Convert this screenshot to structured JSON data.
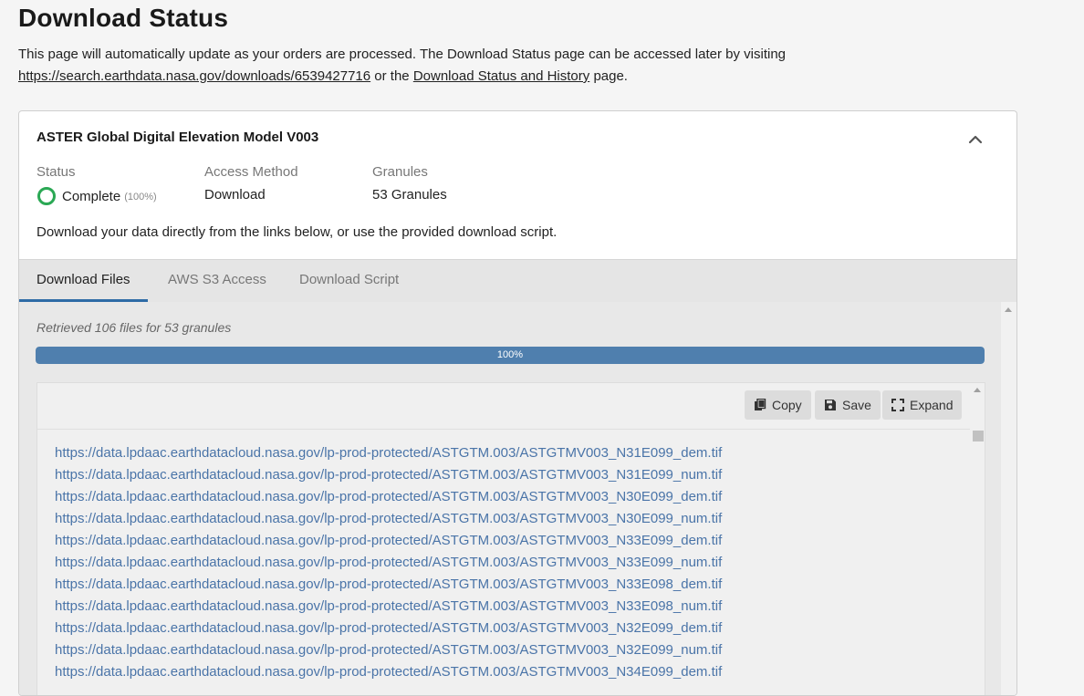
{
  "page": {
    "title": "Download Status",
    "intro_text": "This page will automatically update as your orders are processed. The Download Status page can be accessed later by visiting",
    "intro_link_url": "https://search.earthdata.nasa.gov/downloads/6539427716",
    "intro_or": "or the",
    "intro_link_history": "Download Status and History",
    "intro_end": "page."
  },
  "order": {
    "title": "ASTER Global Digital Elevation Model V003",
    "collapse_icon": "chevron-up-icon",
    "status_label": "Status",
    "status_value": "Complete",
    "status_percent": "(100%)",
    "status_color": "#2aa854",
    "access_label": "Access Method",
    "access_value": "Download",
    "granules_label": "Granules",
    "granules_value": "53 Granules",
    "description": "Download your data directly from the links below, or use the provided download script."
  },
  "tabs": [
    {
      "label": "Download Files",
      "active": true
    },
    {
      "label": "AWS S3 Access",
      "active": false
    },
    {
      "label": "Download Script",
      "active": false
    }
  ],
  "files": {
    "retrieved_text": "Retrieved 106 files for 53 granules",
    "progress_value": 100,
    "progress_label": "100%",
    "progress_color": "#4f7fae",
    "toolbar": {
      "copy_label": "Copy",
      "copy_icon": "copy-icon",
      "save_label": "Save",
      "save_icon": "floppy-disk-icon",
      "expand_label": "Expand",
      "expand_icon": "expand-icon"
    },
    "links": [
      "https://data.lpdaac.earthdatacloud.nasa.gov/lp-prod-protected/ASTGTM.003/ASTGTMV003_N31E099_dem.tif",
      "https://data.lpdaac.earthdatacloud.nasa.gov/lp-prod-protected/ASTGTM.003/ASTGTMV003_N31E099_num.tif",
      "https://data.lpdaac.earthdatacloud.nasa.gov/lp-prod-protected/ASTGTM.003/ASTGTMV003_N30E099_dem.tif",
      "https://data.lpdaac.earthdatacloud.nasa.gov/lp-prod-protected/ASTGTM.003/ASTGTMV003_N30E099_num.tif",
      "https://data.lpdaac.earthdatacloud.nasa.gov/lp-prod-protected/ASTGTM.003/ASTGTMV003_N33E099_dem.tif",
      "https://data.lpdaac.earthdatacloud.nasa.gov/lp-prod-protected/ASTGTM.003/ASTGTMV003_N33E099_num.tif",
      "https://data.lpdaac.earthdatacloud.nasa.gov/lp-prod-protected/ASTGTM.003/ASTGTMV003_N33E098_dem.tif",
      "https://data.lpdaac.earthdatacloud.nasa.gov/lp-prod-protected/ASTGTM.003/ASTGTMV003_N33E098_num.tif",
      "https://data.lpdaac.earthdatacloud.nasa.gov/lp-prod-protected/ASTGTM.003/ASTGTMV003_N32E099_dem.tif",
      "https://data.lpdaac.earthdatacloud.nasa.gov/lp-prod-protected/ASTGTM.003/ASTGTMV003_N32E099_num.tif",
      "https://data.lpdaac.earthdatacloud.nasa.gov/lp-prod-protected/ASTGTM.003/ASTGTMV003_N34E099_dem.tif"
    ]
  }
}
